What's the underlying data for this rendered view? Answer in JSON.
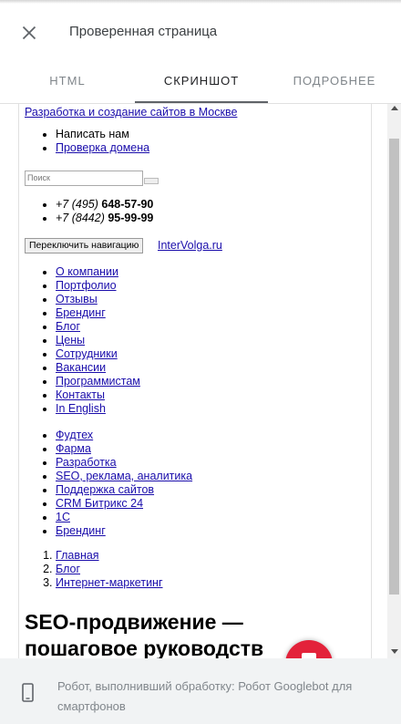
{
  "header": {
    "title": "Проверенная страница"
  },
  "tabs": [
    {
      "label": "HTML"
    },
    {
      "label": "СКРИНШОТ"
    },
    {
      "label": "ПОДРОБНЕЕ"
    }
  ],
  "screenshot": {
    "top_link": "Разработка и создание сайтов в Москве",
    "top_menu": [
      {
        "label": "Написать нам",
        "link": false
      },
      {
        "label": "Проверка домена",
        "link": true
      }
    ],
    "search_placeholder": "Поиск",
    "phones": [
      {
        "code": "+7 (495)",
        "number": "648-57-90"
      },
      {
        "code": "+7 (8442)",
        "number": "95-99-99"
      }
    ],
    "nav_toggle_label": "Переключить навигацию",
    "brand_link": "InterVolga.ru",
    "main_menu": [
      "О компании",
      "Портфолио",
      "Отзывы",
      "Брендинг",
      "Блог",
      "Цены",
      "Сотрудники",
      "Вакансии",
      "Программистам",
      "Контакты",
      "In English"
    ],
    "services_menu": [
      "Фудтех",
      "Фарма",
      "Разработка",
      "SEO, реклама, аналитика",
      "Поддержка сайтов",
      "CRM Битрикс 24",
      "1С",
      "Брендинг"
    ],
    "breadcrumbs": [
      "Главная",
      "Блог",
      "Интернет-маркетинг"
    ],
    "headline_line1": "SEO-продвижение —",
    "headline_line2": "пошаговое руководств"
  },
  "colors": {
    "link": "#1a0dab",
    "chat_button": "#e3223a",
    "footer_bg": "#f1f3f4"
  },
  "footer": {
    "text": "Робот, выполнивший обработку: Робот Googlebot для смартфонов"
  }
}
